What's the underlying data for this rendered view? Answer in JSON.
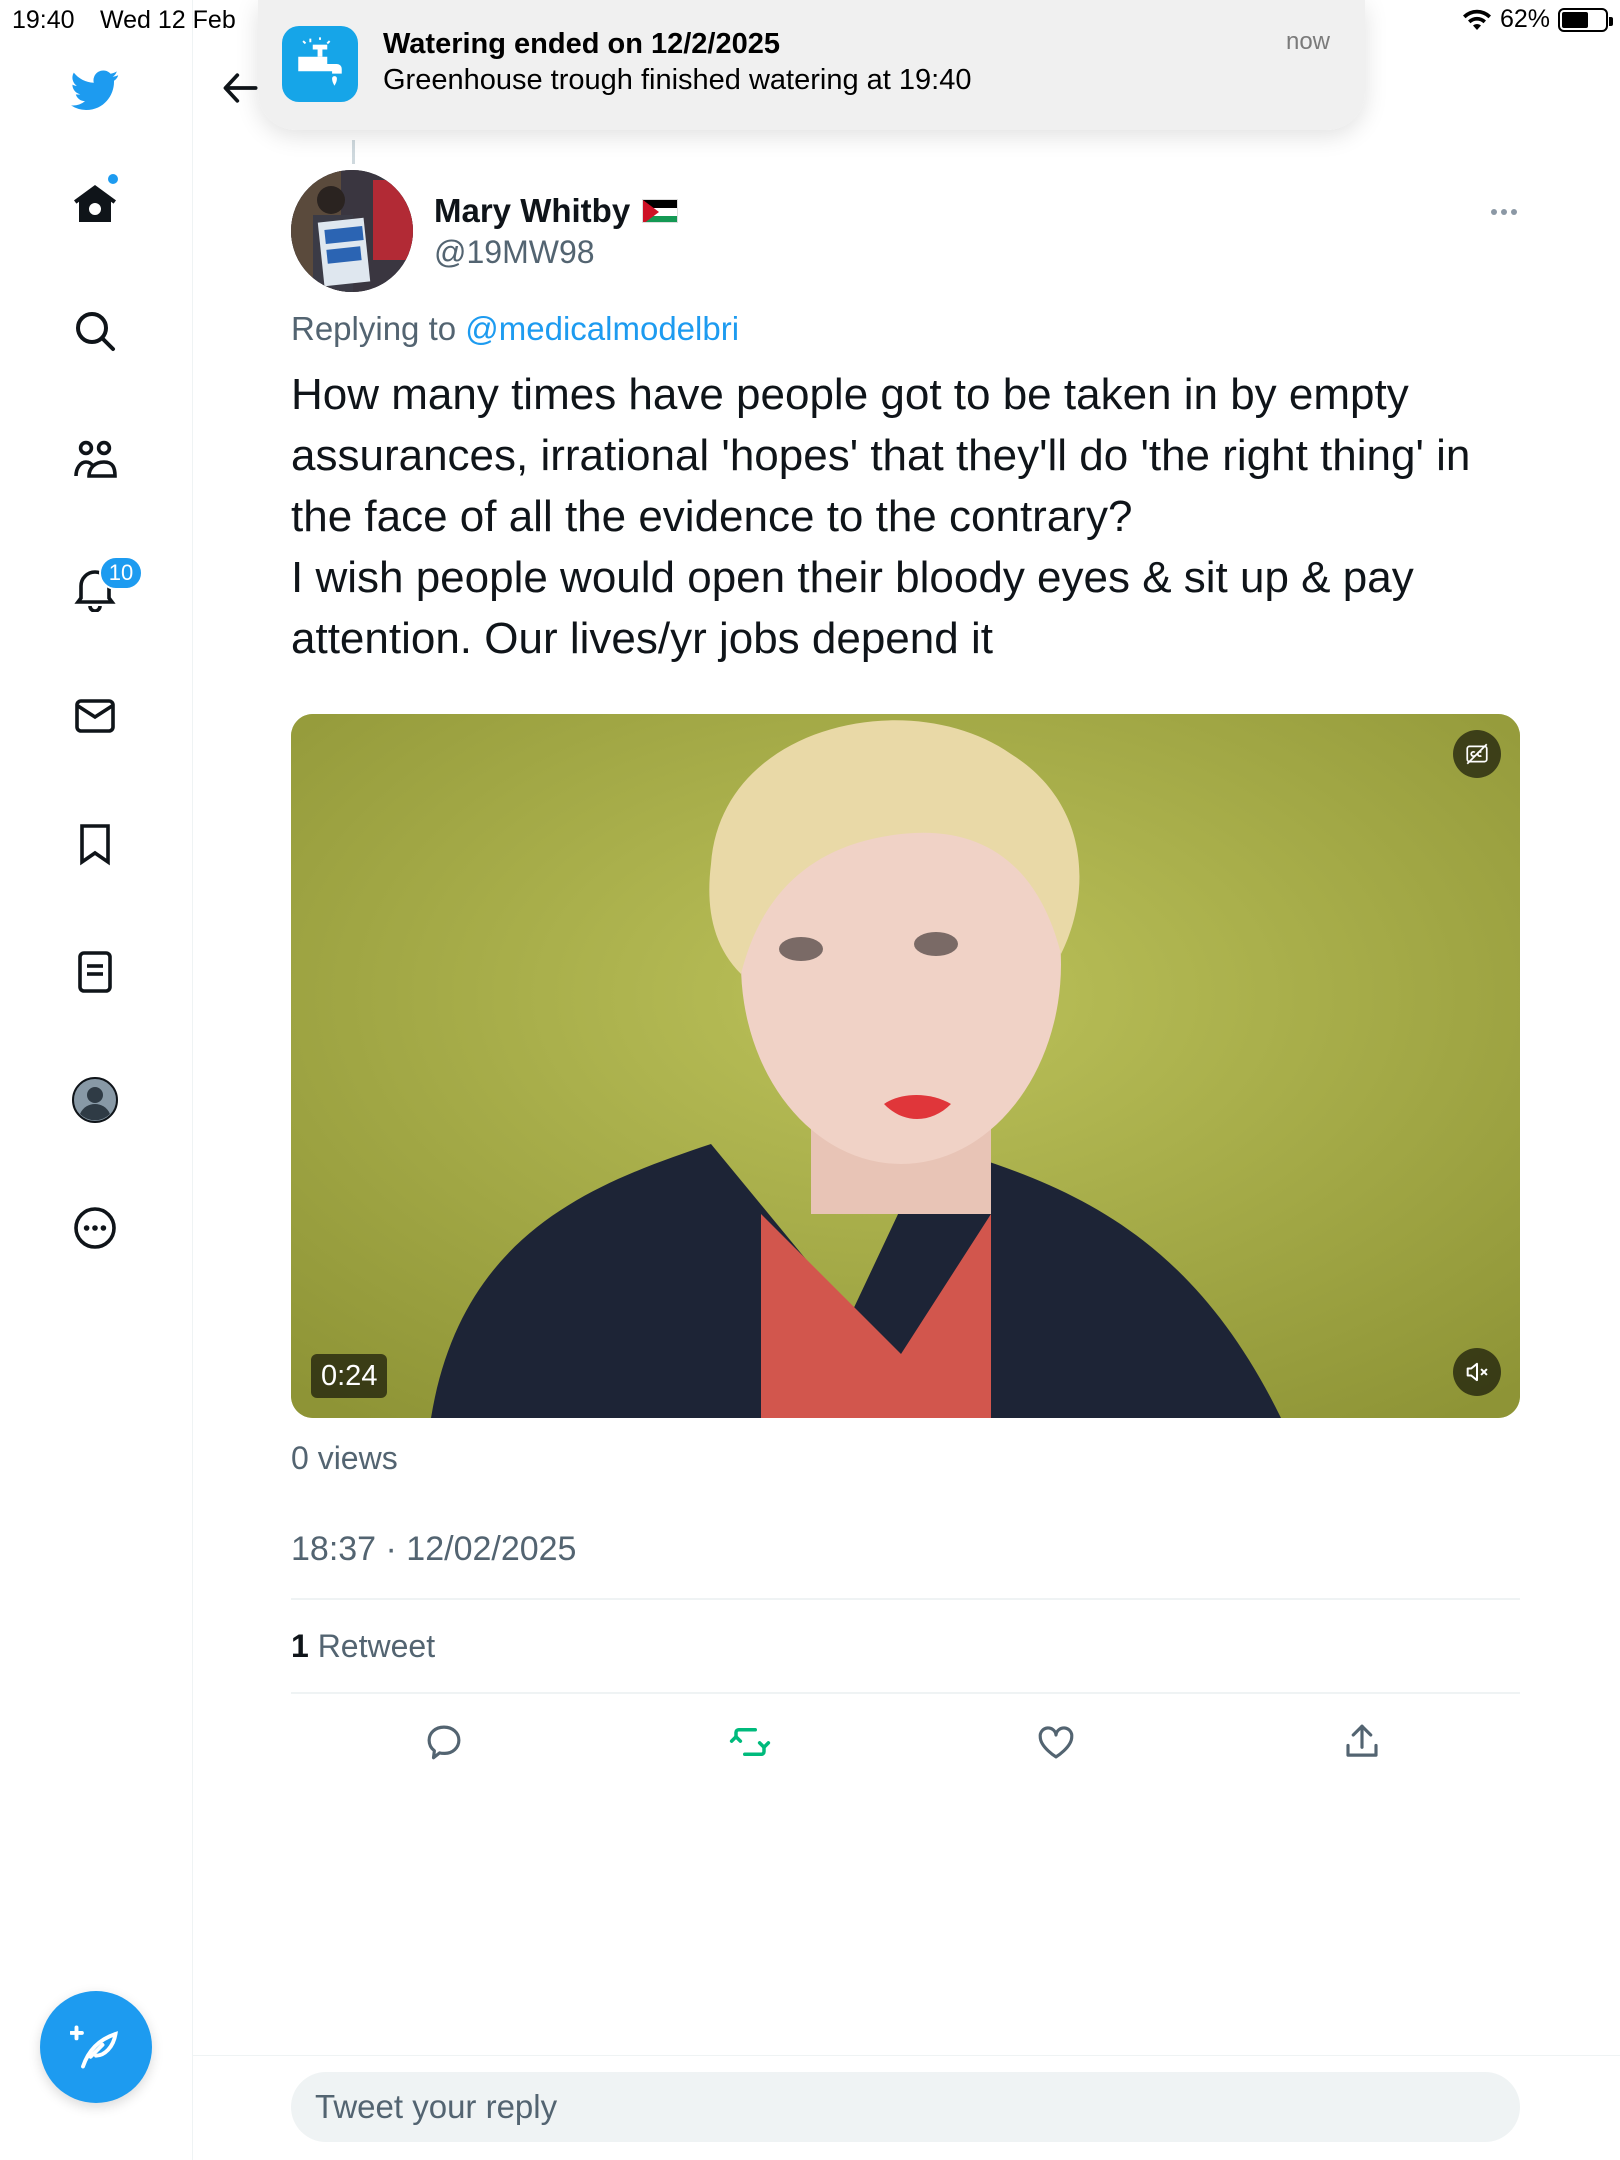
{
  "status_bar": {
    "time": "19:40",
    "date": "Wed 12 Feb",
    "battery": "62%",
    "battery_level": 0.62
  },
  "notification": {
    "title": "Watering ended on 12/2/2025",
    "body": "Greenhouse trough finished watering at 19:40",
    "time": "now"
  },
  "sidebar": {
    "items": [
      {
        "name": "twitter-logo",
        "icon": "twitter-bird"
      },
      {
        "name": "home",
        "icon": "home"
      },
      {
        "name": "explore",
        "icon": "search"
      },
      {
        "name": "communities",
        "icon": "people"
      },
      {
        "name": "notifications",
        "icon": "bell"
      },
      {
        "name": "messages",
        "icon": "envelope"
      },
      {
        "name": "bookmarks",
        "icon": "bookmark"
      },
      {
        "name": "lists",
        "icon": "list"
      },
      {
        "name": "profile",
        "icon": "avatar"
      },
      {
        "name": "more",
        "icon": "more-circle"
      }
    ],
    "notifications_badge": "10"
  },
  "tweet": {
    "author_name": "Mary Whitby",
    "author_handle": "@19MW98",
    "replying_prefix": "Replying to ",
    "replying_to": "@medicalmodelbri",
    "text": "How many times have people got to be taken in by empty assurances, irrational 'hopes' that they'll do 'the right thing' in the face of all the evidence to the contrary?\nI wish people would open their bloody eyes & sit up & pay attention. Our lives/yr jobs depend it",
    "video": {
      "duration": "0:24"
    },
    "views": "0 views",
    "timestamp": "18:37 · 12/02/2025",
    "retweet_count": "1",
    "retweet_label": " Retweet"
  },
  "reply": {
    "placeholder": "Tweet your reply"
  },
  "colors": {
    "accent": "#1d9bf0",
    "retweet_green": "#00ba7c",
    "text": "#0f1419",
    "secondary": "#536471"
  }
}
